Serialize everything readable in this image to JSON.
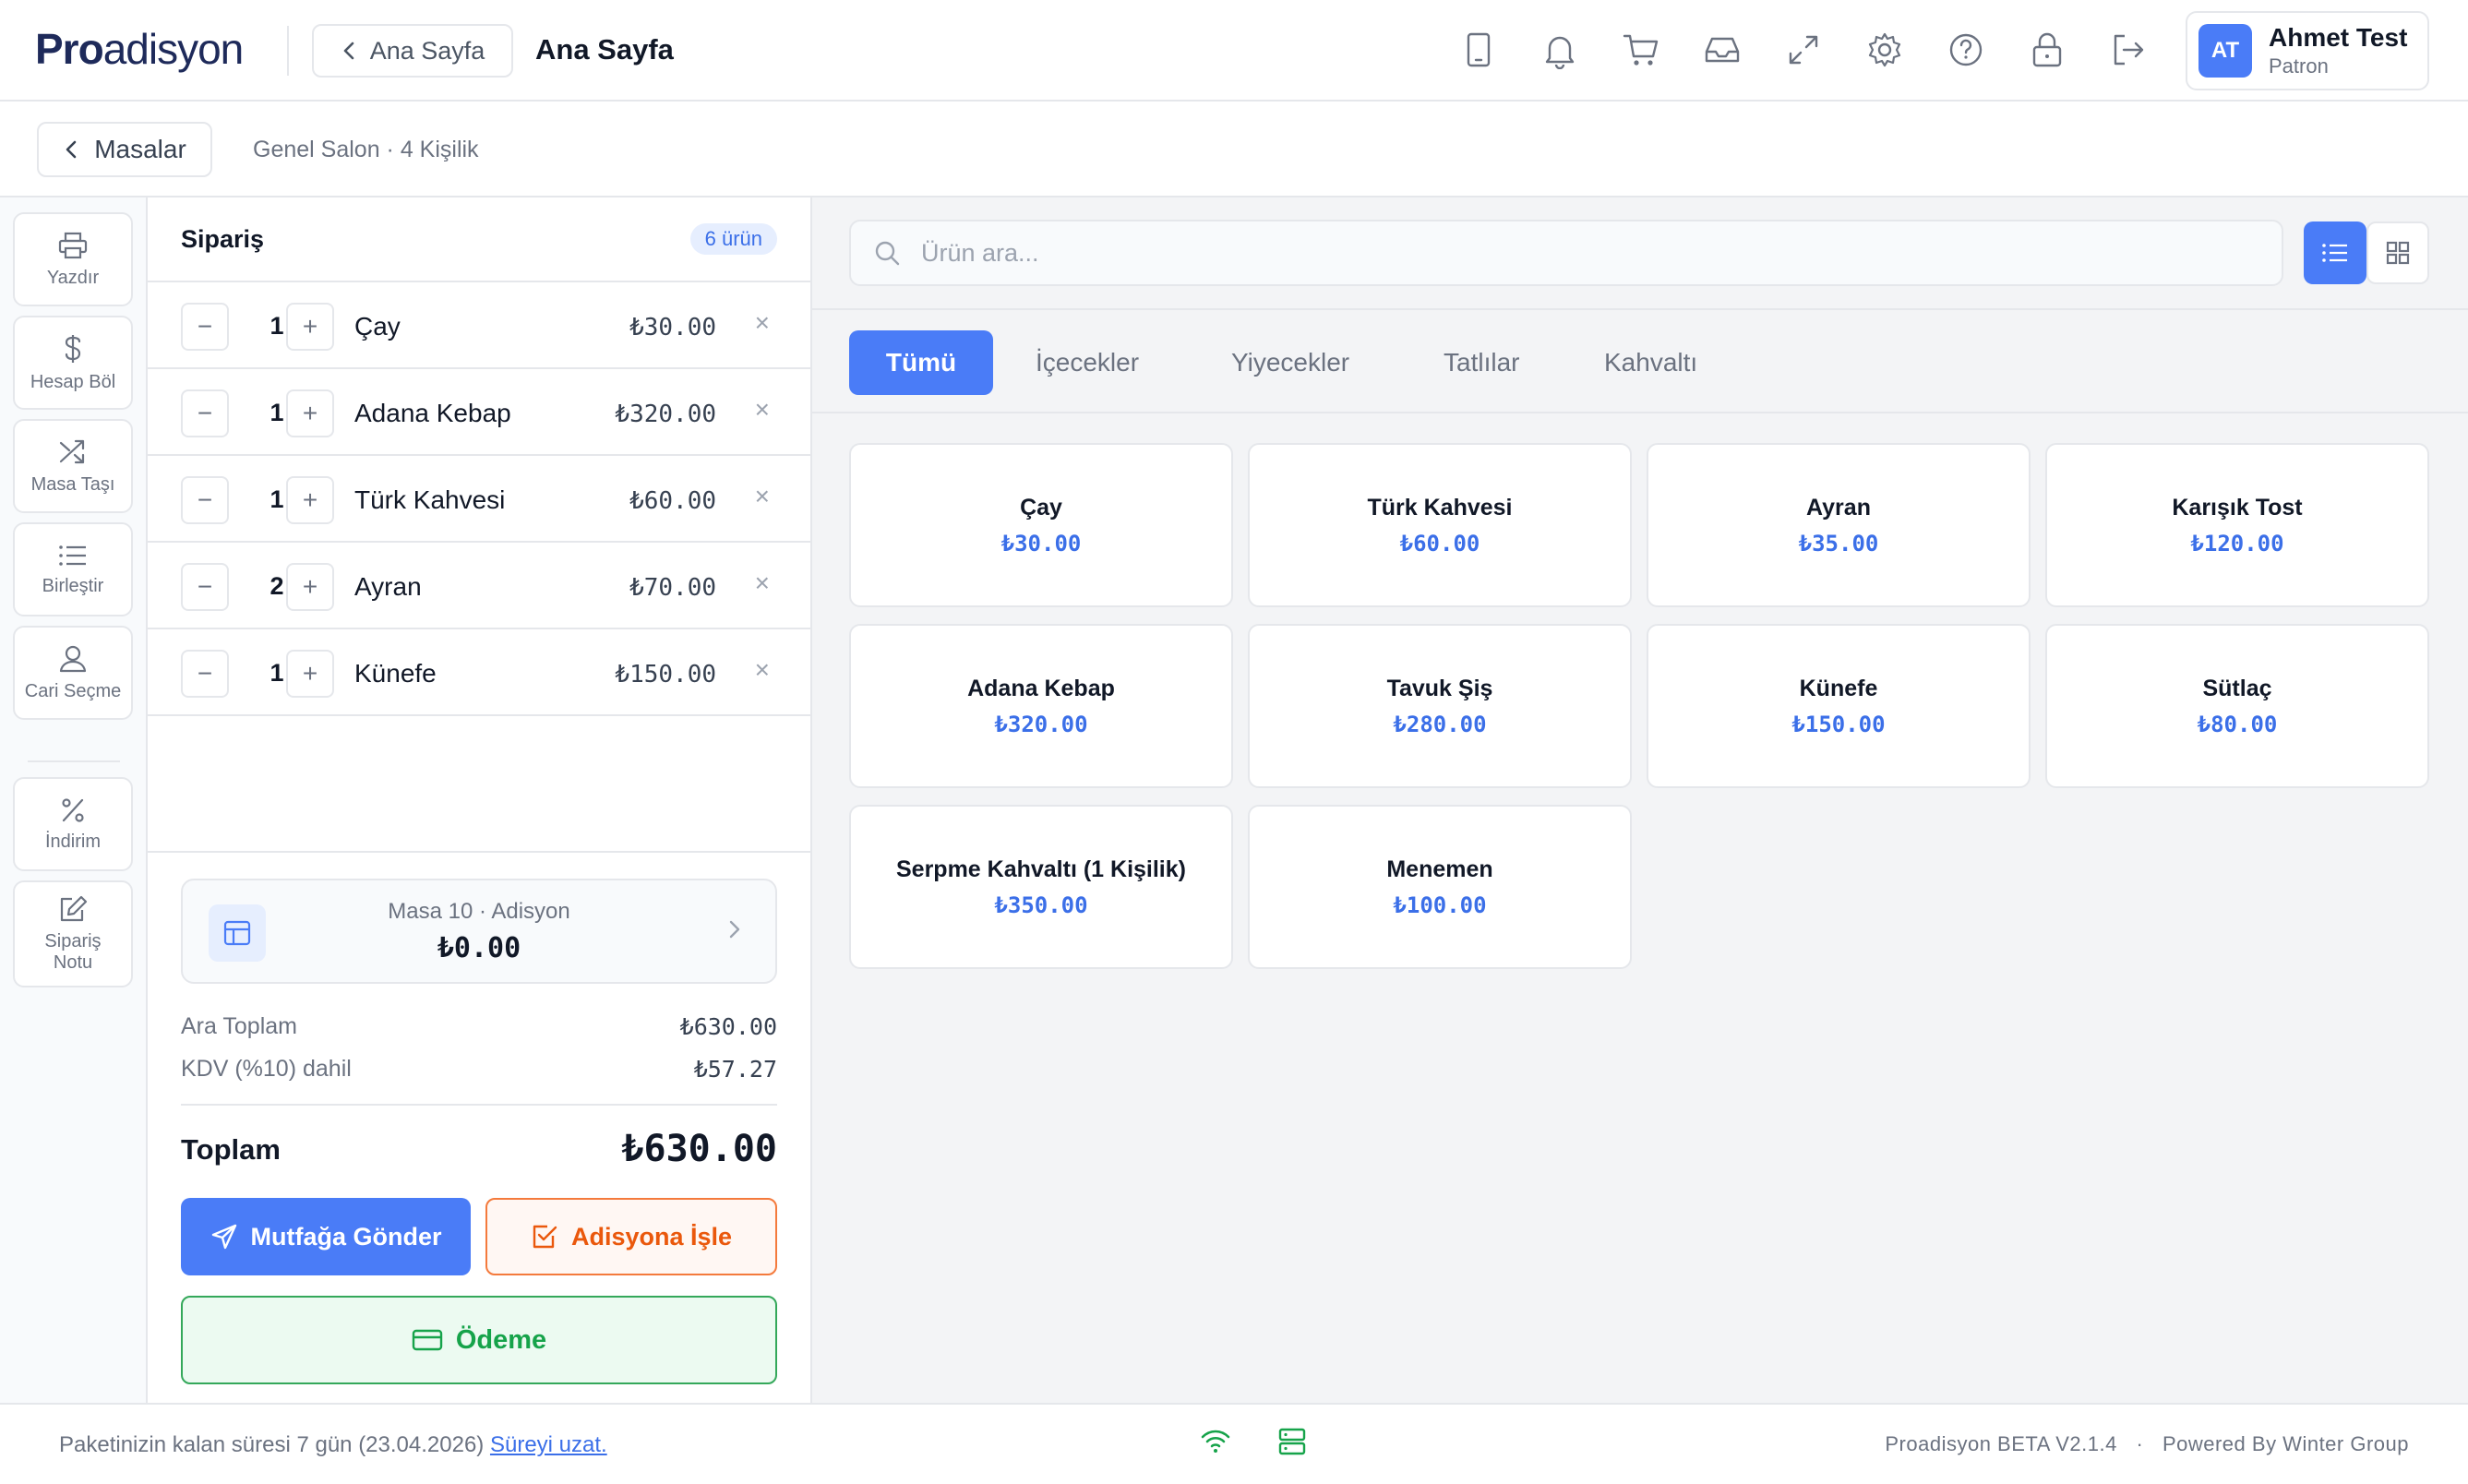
{
  "colors": {
    "accent": "#4a7cf7",
    "warning": "#ea580c",
    "success": "#16a34a"
  },
  "header": {
    "logo_bold": "Pro",
    "logo_rest": "adisyon",
    "back_label": "Ana Sayfa",
    "title": "Ana Sayfa",
    "icons": [
      "tablet-icon",
      "bell-icon",
      "cart-icon",
      "inbox-icon",
      "expand-icon",
      "gear-icon",
      "help-icon",
      "lock-icon",
      "logout-icon"
    ],
    "user": {
      "initials": "AT",
      "name": "Ahmet Test",
      "role": "Patron"
    }
  },
  "subheader": {
    "back_label": "Masalar",
    "info": "Genel Salon · 4 Kişilik"
  },
  "tools": [
    {
      "label": "Yazdır",
      "icon": "printer-icon"
    },
    {
      "label": "Hesap Böl",
      "icon": "dollar-icon"
    },
    {
      "label": "Masa Taşı",
      "icon": "shuffle-icon"
    },
    {
      "label": "Birleştir",
      "icon": "list-icon"
    },
    {
      "label": "Cari Seçme",
      "icon": "user-icon"
    },
    {
      "label": "İndirim",
      "icon": "percent-icon"
    },
    {
      "label": "Sipariş Notu",
      "icon": "edit-icon"
    }
  ],
  "order": {
    "title": "Sipariş",
    "count_badge": "6 ürün",
    "items": [
      {
        "qty": "1",
        "name": "Çay",
        "price": "₺30.00"
      },
      {
        "qty": "1",
        "name": "Adana Kebap",
        "price": "₺320.00"
      },
      {
        "qty": "1",
        "name": "Türk Kahvesi",
        "price": "₺60.00"
      },
      {
        "qty": "2",
        "name": "Ayran",
        "price": "₺70.00"
      },
      {
        "qty": "1",
        "name": "Künefe",
        "price": "₺150.00"
      }
    ],
    "minus": "−",
    "plus": "+",
    "remove": "×",
    "adisyon": {
      "label": "Masa 10 · Adisyon",
      "amount": "₺0.00"
    },
    "subtotal_label": "Ara Toplam",
    "subtotal": "₺630.00",
    "tax_label": "KDV (%10) dahil",
    "tax": "₺57.27",
    "total_label": "Toplam",
    "total": "₺630.00",
    "send_kitchen": "Mutfağa Gönder",
    "process": "Adisyona İşle",
    "pay": "Ödeme"
  },
  "products": {
    "search_placeholder": "Ürün ara...",
    "categories": [
      "Tümü",
      "İçecekler",
      "Yiyecekler",
      "Tatlılar",
      "Kahvaltı"
    ],
    "items": [
      {
        "name": "Çay",
        "price": "₺30.00"
      },
      {
        "name": "Türk Kahvesi",
        "price": "₺60.00"
      },
      {
        "name": "Ayran",
        "price": "₺35.00"
      },
      {
        "name": "Karışık Tost",
        "price": "₺120.00"
      },
      {
        "name": "Adana Kebap",
        "price": "₺320.00"
      },
      {
        "name": "Tavuk Şiş",
        "price": "₺280.00"
      },
      {
        "name": "Künefe",
        "price": "₺150.00"
      },
      {
        "name": "Sütlaç",
        "price": "₺80.00"
      },
      {
        "name": "Serpme Kahvaltı (1 Kişilik)",
        "price": "₺350.00"
      },
      {
        "name": "Menemen",
        "price": "₺100.00"
      }
    ]
  },
  "footer": {
    "package_text": "Paketinizin kalan süresi 7 gün (23.04.2026)",
    "extend_link": "Süreyi uzat.",
    "version": "Proadisyon BETA V2.1.4",
    "separator": "·",
    "powered": "Powered By Winter Group"
  }
}
